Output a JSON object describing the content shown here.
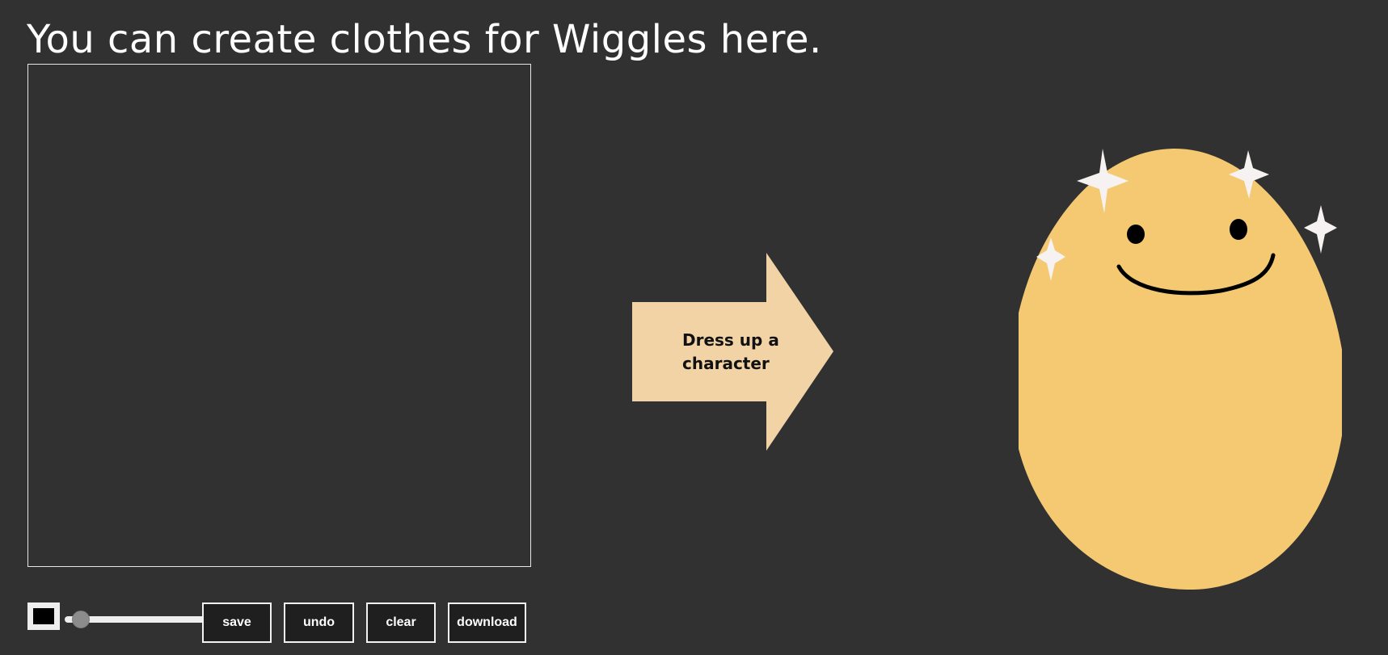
{
  "header": {
    "title": "You can create clothes for Wiggles here."
  },
  "toolbar": {
    "brush_color": "#000000",
    "brush_size_fraction": 0.05,
    "buttons": {
      "save": "save",
      "undo": "undo",
      "clear": "clear",
      "download": "download"
    }
  },
  "cta": {
    "label_line1": "Dress up a",
    "label_line2": "character",
    "arrow_color": "#f2d3a6"
  },
  "character": {
    "body_color": "#f4c971",
    "sparkle_color": "#f7f2f2"
  },
  "colors": {
    "background": "#313131",
    "text": "#ffffff"
  }
}
